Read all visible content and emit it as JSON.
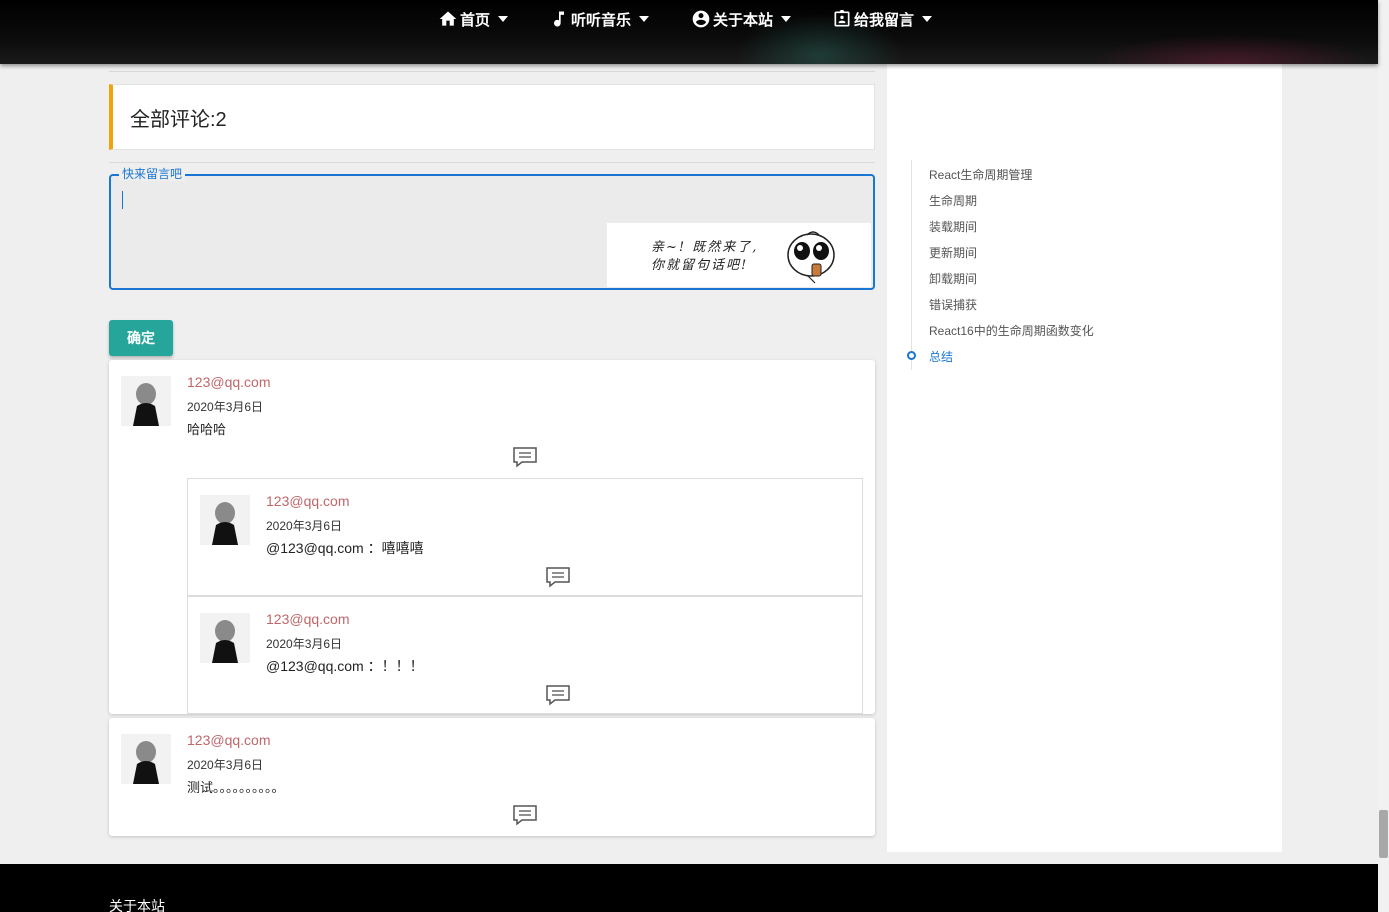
{
  "nav": {
    "items": [
      {
        "label": "首页",
        "icon": "home-icon"
      },
      {
        "label": "听听音乐",
        "icon": "music-note-icon"
      },
      {
        "label": "关于本站",
        "icon": "account-circle-icon"
      },
      {
        "label": "给我留言",
        "icon": "contact-card-icon"
      }
    ]
  },
  "comments": {
    "count_label": "全部评论:2",
    "input": {
      "legend": "快来留言吧",
      "value": ""
    },
    "sticker": {
      "line1": "亲~! 既然来了,",
      "line2": "你就留句话吧!"
    },
    "submit_label": "确定",
    "list": [
      {
        "user": "123@qq.com",
        "date": "2020年3月6日",
        "text": "哈哈哈",
        "replies": [
          {
            "user": "123@qq.com",
            "date": "2020年3月6日",
            "text": "@123@qq.com ：嘻嘻嘻"
          },
          {
            "user": "123@qq.com",
            "date": "2020年3月6日",
            "text": "@123@qq.com ：！！！"
          }
        ]
      },
      {
        "user": "123@qq.com",
        "date": "2020年3月6日",
        "text": "测试。。。。。。。。。。",
        "replies": []
      }
    ]
  },
  "toc": {
    "items": [
      "React生命周期管理",
      "生命周期",
      "装载期间",
      "更新期间",
      "卸载期间",
      "错误捕获",
      "React16中的生命周期函数变化",
      "总结"
    ],
    "active_index": 7
  },
  "footer": {
    "title": "关于本站"
  },
  "colors": {
    "accent": "#1976d2",
    "button": "#26a69a",
    "username": "#c0676b",
    "count_border": "#f0a30a"
  }
}
